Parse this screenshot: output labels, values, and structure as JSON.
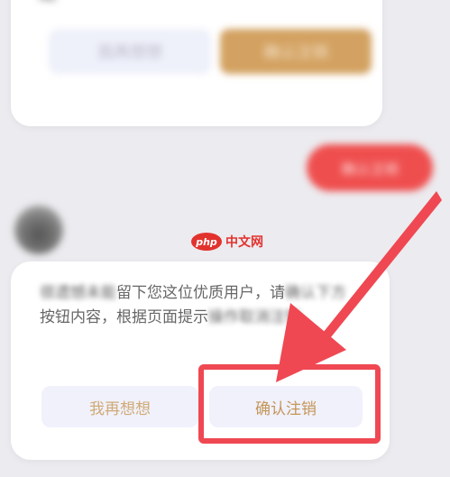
{
  "colors": {
    "accent_red": "#ef4852",
    "gold": "#d3a262",
    "button_bg": "#f0f1fb"
  },
  "top_card": {
    "partial_char": "是",
    "cancel_button_label": "我再想想",
    "confirm_button_label": "确认注销"
  },
  "chat_bubble": {
    "label": "确认注销"
  },
  "watermark": {
    "logo": "php",
    "text": "中文网"
  },
  "dialog": {
    "text_parts": [
      "很遗憾未能",
      "留下您这位优质用户，请",
      "确",
      "认下方",
      "按钮内容，根据页面提示",
      "操",
      "作",
      "取",
      "消注销。"
    ],
    "cancel_label": "我再想想",
    "confirm_label": "确认注销"
  },
  "annotation": {
    "icon": "arrow-icon"
  }
}
